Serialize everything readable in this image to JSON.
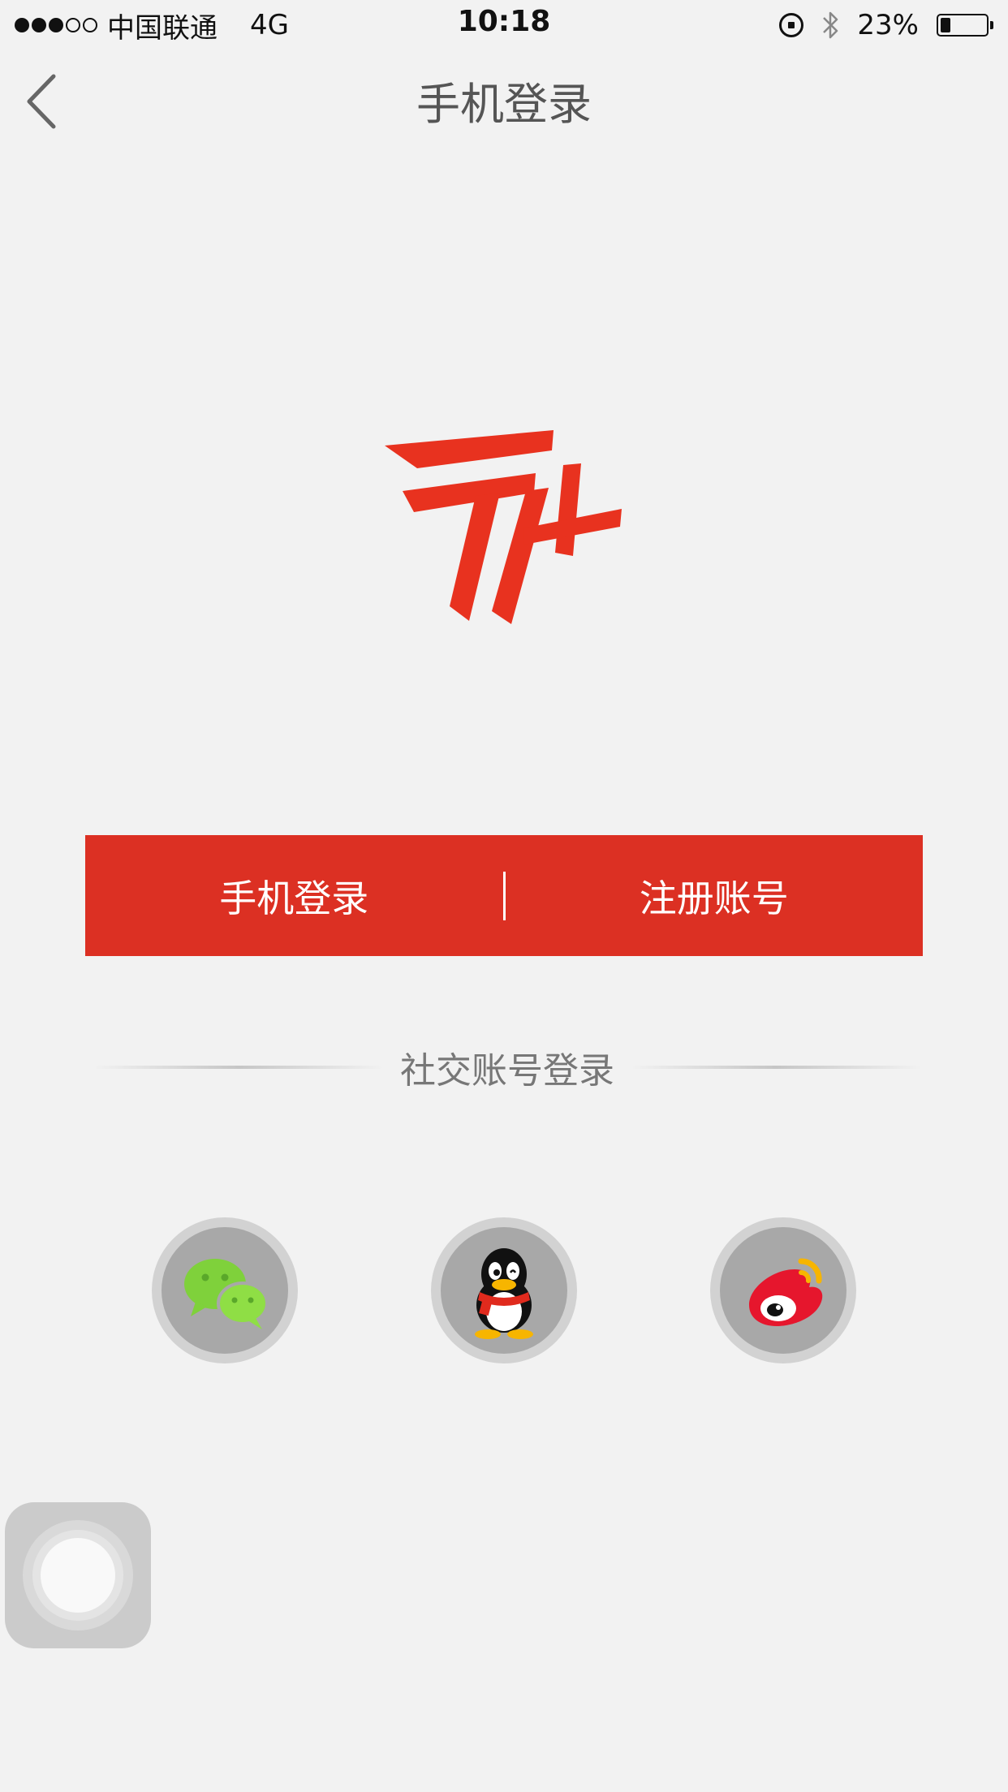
{
  "status_bar": {
    "signal_filled": 3,
    "signal_total": 5,
    "carrier": "中国联通",
    "network": "4G",
    "time": "10:18",
    "battery_percent": "23%",
    "battery_level": 0.23,
    "icons": [
      "orientation-lock-icon",
      "bluetooth-icon",
      "battery-icon"
    ]
  },
  "nav": {
    "back_icon": "chevron-left-icon",
    "title": "手机登录"
  },
  "logo": {
    "icon": "app-logo-icon",
    "color": "#e8321f"
  },
  "actions": {
    "background": "#dc3023",
    "phone_login_label": "手机登录",
    "register_label": "注册账号"
  },
  "social": {
    "title": "社交账号登录",
    "buttons": [
      {
        "name": "wechat",
        "icon": "wechat-icon",
        "color": "#7fd13b"
      },
      {
        "name": "qq",
        "icon": "qq-penguin-icon",
        "color": "#e02a1d"
      },
      {
        "name": "weibo",
        "icon": "weibo-icon",
        "color": "#e6162d"
      }
    ]
  },
  "assistive_touch": {
    "icon": "assistive-touch-icon"
  }
}
